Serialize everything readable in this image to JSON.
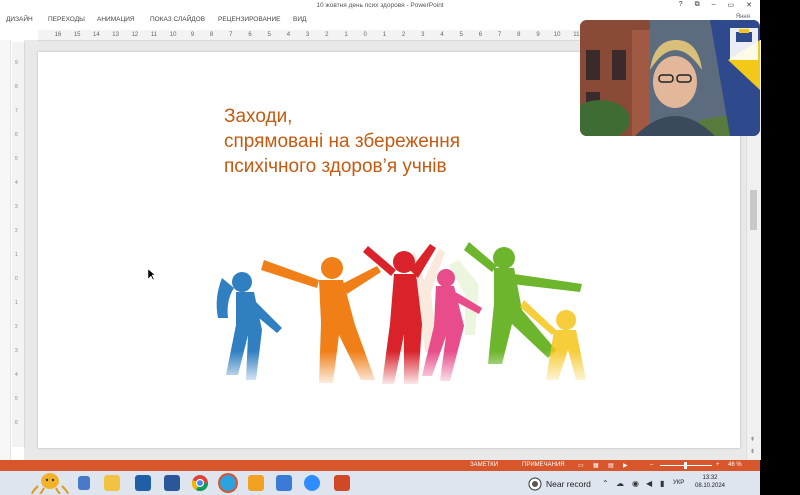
{
  "window": {
    "title": "10 жовтня день псих здоровя - PowerPoint",
    "controls": [
      "?",
      "⧉",
      "–",
      "▭",
      "✕"
    ]
  },
  "ribbon": {
    "tabs": [
      "ДИЗАЙН",
      "ПЕРЕХОДЫ",
      "АНИМАЦИЯ",
      "ПОКАЗ СЛАЙДОВ",
      "РЕЦЕНЗИРОВАНИЕ",
      "ВИД"
    ],
    "user": "Яння"
  },
  "ruler": {
    "ticks": [
      "16",
      "15",
      "14",
      "13",
      "12",
      "11",
      "10",
      "9",
      "8",
      "7",
      "6",
      "5",
      "4",
      "3",
      "2",
      "1",
      "0",
      "1",
      "2",
      "3",
      "4",
      "5",
      "6",
      "7",
      "8",
      "9",
      "10",
      "11",
      "12"
    ]
  },
  "slide": {
    "title_lines": [
      "Заходи,",
      "спрямовані на збереження",
      "психічного  здоров’я учнів"
    ],
    "title_color": "#c55a11",
    "image": "dancing-silhouettes"
  },
  "status_bar": {
    "notes": "ЗАМЕТКИ",
    "comments": "ПРИМЕЧАНИЯ",
    "zoom": "46 %",
    "color": "#d8562b"
  },
  "webcam": {
    "logo_text": "ХЕРСОНСЬКИЙ ДЕРЖАВНИЙ ПЕДАГОГІЧНИЙ УНІВЕРСИТЕТ"
  },
  "taskbar": {
    "apps": [
      "octopus-icon",
      "file-explorer-icon",
      "folder-icon",
      "mail-icon",
      "word-icon",
      "chrome-icon",
      "telegram-icon",
      "yellow-app-icon",
      "mail-app-icon",
      "floppy-save-icon",
      "zoom-icon",
      "powerpoint-icon"
    ],
    "near_record": "Near record",
    "language": "УКР",
    "time": "13:32",
    "date": "08.10.2024"
  }
}
